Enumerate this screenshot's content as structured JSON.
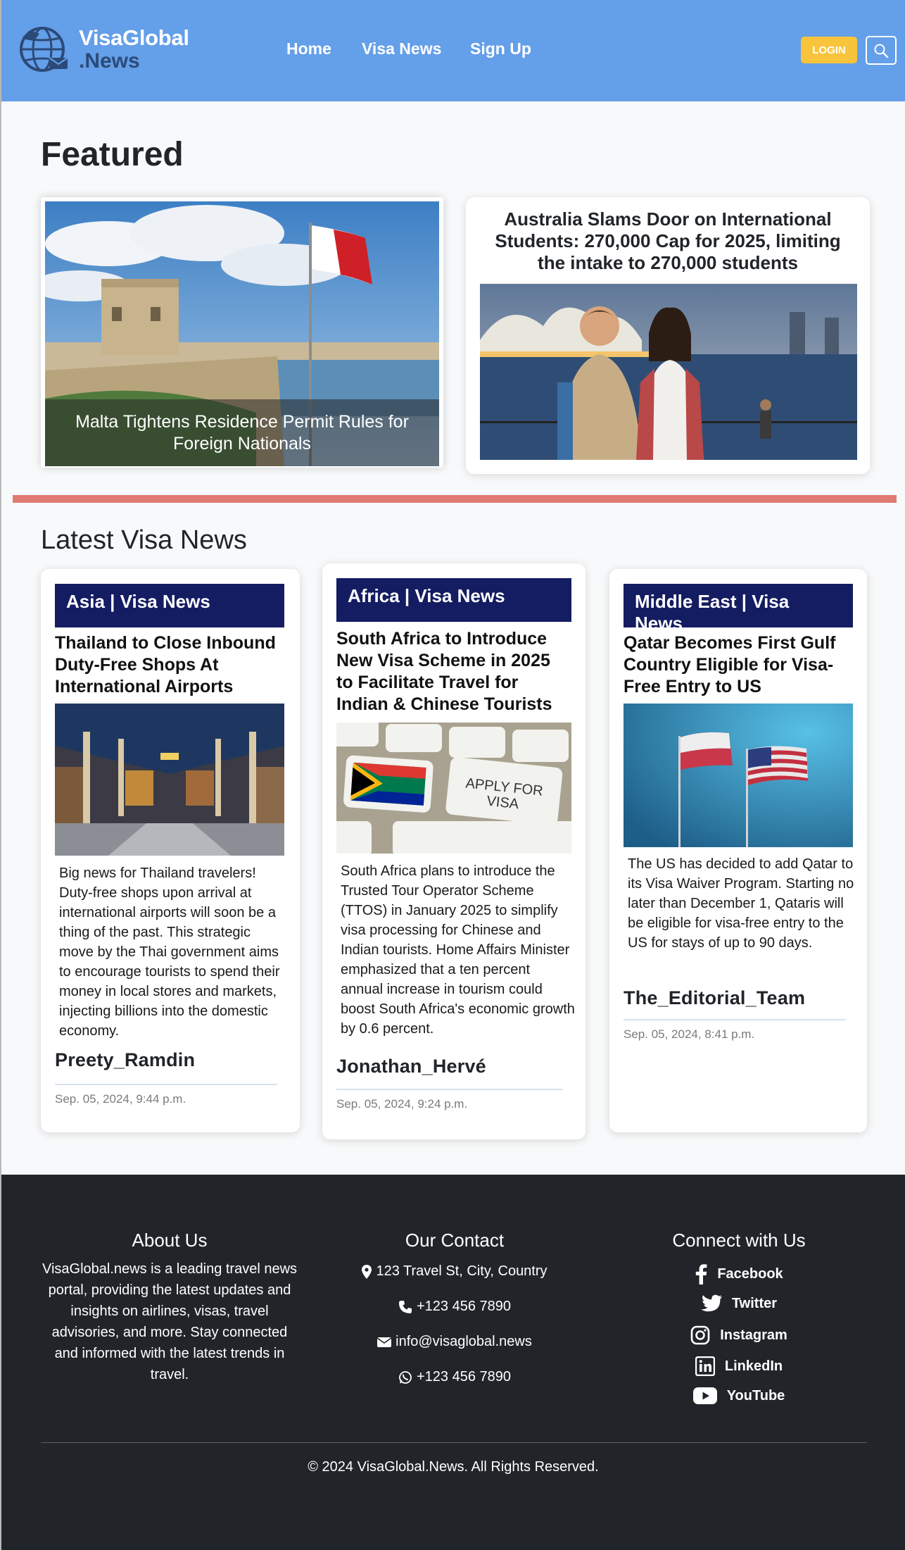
{
  "header": {
    "brand_line1": "VisaGlobal",
    "brand_line2": ".News",
    "nav": [
      "Home",
      "Visa News",
      "Sign Up"
    ],
    "login_label": "LOGIN",
    "search_icon": "search-icon"
  },
  "featured": {
    "title": "Featured",
    "left_caption": "Malta Tightens Residence Permit Rules for Foreign Nationals",
    "right_title": "Australia Slams Door on International Students: 270,000 Cap for 2025, limiting the intake to 270,000 students"
  },
  "latest": {
    "title": "Latest Visa News",
    "cards": [
      {
        "category": "Asia | Visa News",
        "title": "Thailand to Close Inbound Duty-Free Shops At International Airports",
        "body": "Big news for Thailand travelers! Duty-free shops upon arrival at international airports will soon be a thing of the past. This strategic move by the Thai government aims to encourage tourists to spend their money in local stores and markets, injecting billions into the domestic economy.",
        "author": "Preety_Ramdin",
        "date": "Sep. 05, 2024, 9:44 p.m."
      },
      {
        "category": "Africa | Visa News",
        "title": "South Africa to Introduce New Visa Scheme in 2025 to Facilitate Travel for Indian & Chinese Tourists",
        "image_text": "APPLY FOR VISA",
        "body": "South Africa plans to introduce the Trusted Tour Operator Scheme (TTOS) in January 2025 to simplify visa processing for Chinese and Indian tourists. Home Affairs Minister emphasized that a ten percent annual increase in tourism could boost South Africa's economic growth by 0.6 percent.",
        "author": "Jonathan_Hervé",
        "date": "Sep. 05, 2024, 9:24 p.m."
      },
      {
        "category": "Middle East | Visa News",
        "title": "Qatar Becomes First Gulf Country Eligible for Visa-Free Entry to US",
        "body": "The US has decided to add Qatar to its Visa Waiver Program. Starting no later than December 1, Qataris will be eligible for visa-free entry to the US for stays of up to 90 days.",
        "author": "The_Editorial_Team",
        "date": "Sep. 05, 2024, 8:41 p.m."
      }
    ]
  },
  "footer": {
    "about_title": "About Us",
    "about_text": "VisaGlobal.news is a leading travel news portal, providing the latest updates and insights on airlines, visas, travel advisories, and more. Stay connected and informed with the latest trends in travel.",
    "contact_title": "Our Contact",
    "contact": {
      "address": "123 Travel St, City, Country",
      "phone": "+123 456 7890",
      "email": "info@visaglobal.news",
      "whatsapp": "+123 456 7890"
    },
    "social_title": "Connect with Us",
    "social": [
      "Facebook",
      "Twitter",
      "Instagram",
      "LinkedIn",
      "YouTube"
    ],
    "copyright": "© 2024 VisaGlobal.News. All Rights Reserved."
  },
  "colors": {
    "navbar": "#649fe9",
    "login": "#f7c43c",
    "category_bar": "#141c62",
    "divider": "#e07a72",
    "footer": "#212529"
  }
}
